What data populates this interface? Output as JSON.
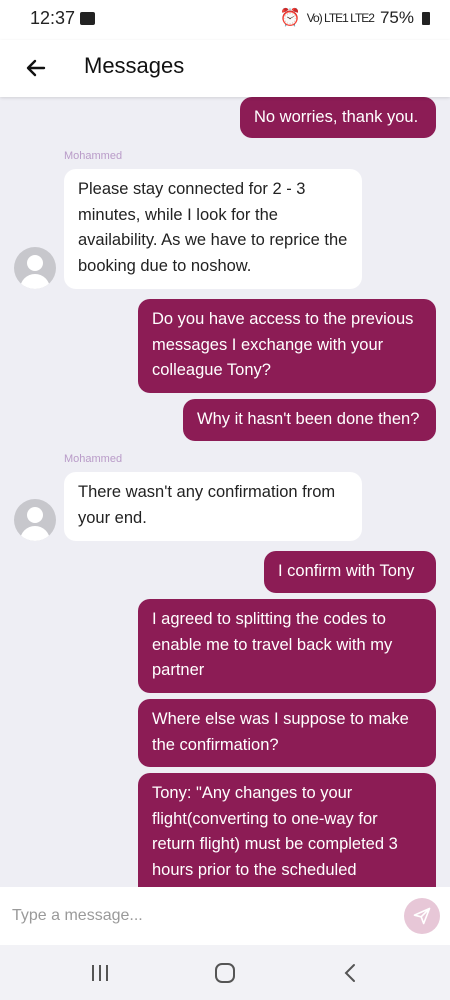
{
  "status": {
    "time": "12:37",
    "signal": "Vo) LTE1 LTE2",
    "battery": "75%"
  },
  "header": {
    "title": "Messages"
  },
  "messages": [
    {
      "dir": "out",
      "text": "No worries, thank you."
    },
    {
      "dir": "in",
      "sender": "Mohammed",
      "text": "Please stay connected for 2 - 3 minutes, while I look for the availability. As we have to reprice the booking due to noshow."
    },
    {
      "dir": "out",
      "text": "Do you have access to the previous messages I exchange with your colleague Tony?"
    },
    {
      "dir": "out",
      "text": "Why it hasn't been done then?"
    },
    {
      "dir": "in",
      "sender": "Mohammed",
      "text": "There wasn't any confirmation from your end."
    },
    {
      "dir": "out",
      "text": "I confirm with Tony"
    },
    {
      "dir": "out",
      "text": "I agreed to splitting the codes to enable me to travel back with my partner"
    },
    {
      "dir": "out",
      "text": "Where else was I suppose to make the confirmation?"
    },
    {
      "dir": "out",
      "text": "Tony: \"Any changes to your flight(converting to one-way for return flight) must be completed 3 hours prior to the scheduled"
    }
  ],
  "composer": {
    "placeholder": "Type a message..."
  },
  "colors": {
    "outgoing": "#8c1c55",
    "incoming": "#ffffff",
    "background": "#eeeef4",
    "sender": "#b99bc8"
  }
}
